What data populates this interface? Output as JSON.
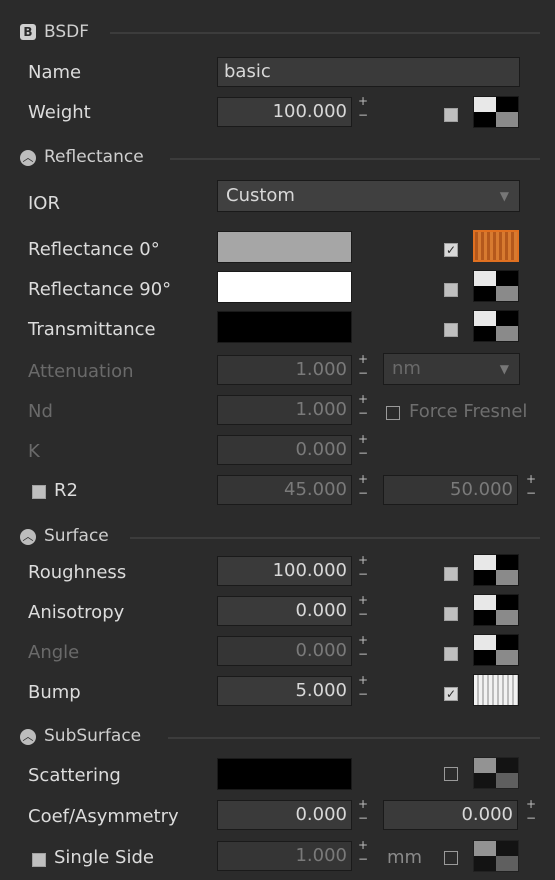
{
  "bsdf": {
    "icon": "B",
    "title": "BSDF",
    "name_label": "Name",
    "name_value": "basic",
    "weight_label": "Weight",
    "weight_value": "100.000"
  },
  "reflectance": {
    "title": "Reflectance",
    "ior_label": "IOR",
    "ior_value": "Custom",
    "refl0_label": "Reflectance 0°",
    "refl90_label": "Reflectance 90°",
    "trans_label": "Transmittance",
    "atten_label": "Attenuation",
    "atten_value": "1.000",
    "atten_unit": "nm",
    "nd_label": "Nd",
    "nd_value": "1.000",
    "force_fresnel": "Force Fresnel",
    "k_label": "K",
    "k_value": "0.000",
    "r2_label": "R2",
    "r2_value1": "45.000",
    "r2_value2": "50.000",
    "colors": {
      "refl0": "#a6a6a6",
      "refl90": "#ffffff",
      "trans": "#000000",
      "accent": "#e07020"
    }
  },
  "surface": {
    "title": "Surface",
    "roughness_label": "Roughness",
    "roughness_value": "100.000",
    "anisotropy_label": "Anisotropy",
    "anisotropy_value": "0.000",
    "angle_label": "Angle",
    "angle_value": "0.000",
    "bump_label": "Bump",
    "bump_value": "5.000"
  },
  "subsurface": {
    "title": "SubSurface",
    "scattering_label": "Scattering",
    "coef_label": "Coef/Asymmetry",
    "coef_value1": "0.000",
    "coef_value2": "0.000",
    "single_side_label": "Single Side",
    "single_side_value": "1.000",
    "single_side_unit": "mm",
    "colors": {
      "scattering": "#000000"
    }
  }
}
